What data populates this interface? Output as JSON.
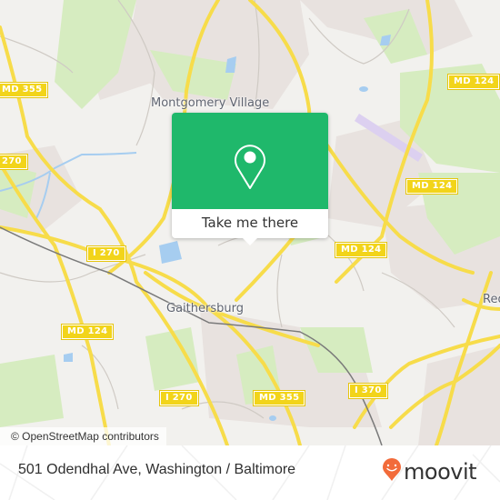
{
  "map": {
    "place_labels": [
      {
        "id": "montgomery-village",
        "text": "Montgomery Village"
      },
      {
        "id": "gaithersburg",
        "text": "Gaithersburg"
      },
      {
        "id": "rockville-partial",
        "text": "Red"
      }
    ],
    "road_shields": [
      {
        "id": "md355-nw",
        "text": "MD 355"
      },
      {
        "id": "i270-w",
        "text": "270"
      },
      {
        "id": "md124-ne",
        "text": "MD 124"
      },
      {
        "id": "md124-e",
        "text": "MD 124"
      },
      {
        "id": "md124-center",
        "text": "MD 124"
      },
      {
        "id": "i270-center",
        "text": "I 270"
      },
      {
        "id": "md124-sw",
        "text": "MD 124"
      },
      {
        "id": "i270-south",
        "text": "I 270"
      },
      {
        "id": "md355-south",
        "text": "MD 355"
      },
      {
        "id": "i370",
        "text": "I 370"
      }
    ],
    "colors": {
      "land": "#f2f1ee",
      "park": "#d6ecc0",
      "urban": "#e8e2df",
      "water": "#a6cdf0",
      "road": "#f7dc4a",
      "rail": "#7a7a7a"
    }
  },
  "popup": {
    "icon": "location-pin-icon",
    "button_label": "Take me there",
    "color": "#1fb86b"
  },
  "attribution": "© OpenStreetMap contributors",
  "footer": {
    "address": "501 Odendhal Ave, Washington / Baltimore",
    "brand": "moovit",
    "brand_color": "#f26b3a"
  }
}
